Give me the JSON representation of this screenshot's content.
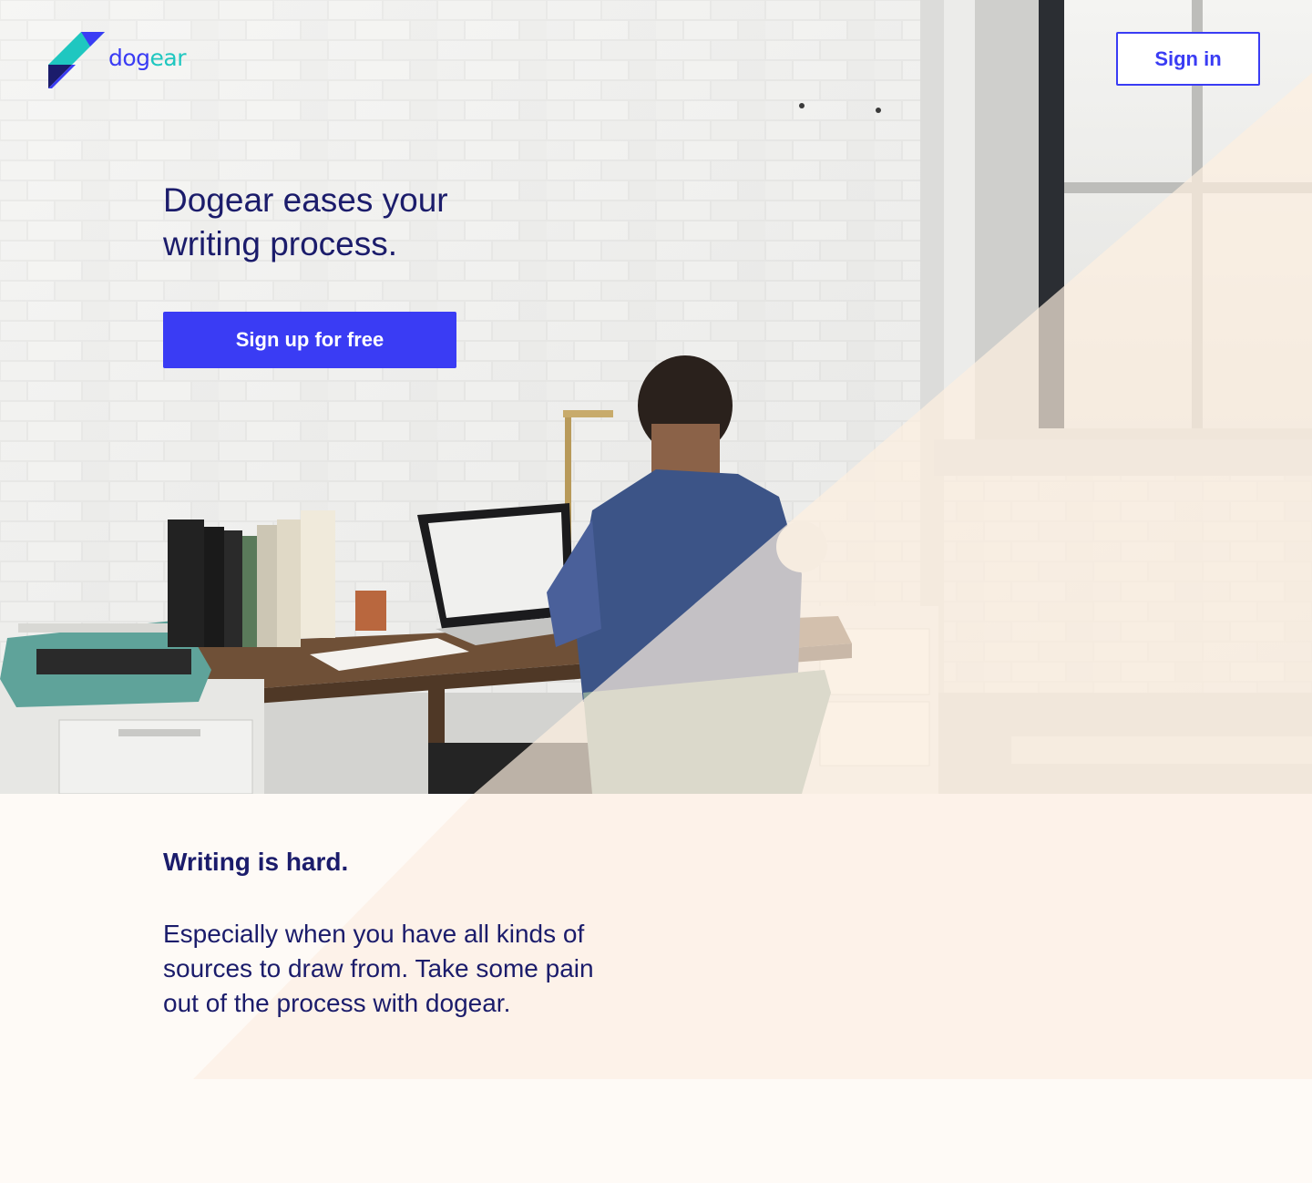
{
  "brand": {
    "name_part1": "dog",
    "name_part2": "ear",
    "primary_color": "#3a3cf4",
    "accent_color": "#1fc7c0",
    "text_color": "#1b1c6b",
    "background_color": "#fefaf6"
  },
  "header": {
    "signin_label": "Sign in"
  },
  "hero": {
    "title": "Dogear eases your writing process.",
    "signup_label": "Sign up for free"
  },
  "intro": {
    "heading": "Writing is hard.",
    "body": "Especially when you have all kinds of sources to draw from. Take some pain out of the process with dogear."
  }
}
